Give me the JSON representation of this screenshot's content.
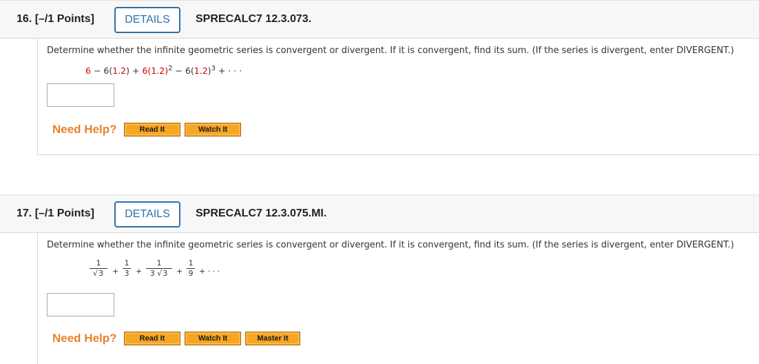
{
  "questions": [
    {
      "number": "16.",
      "points": "[–/1 Points]",
      "details_label": "DETAILS",
      "code": "SPRECALC7 12.3.073.",
      "prompt": "Determine whether the infinite geometric series is convergent or divergent. If it is convergent, find its sum. (If the series is divergent, enter DIVERGENT.)",
      "series": {
        "t1": "6",
        "op1": "−",
        "t2a": "6(",
        "t2b": "1.2",
        "t2c": ")",
        "op2": "+",
        "t3a": "6(",
        "t3b": "1.2",
        "t3c": ")",
        "t3exp": "2",
        "op3": "−",
        "t4a": "6(",
        "t4b": "1.2",
        "t4c": ")",
        "t4exp": "3",
        "op4": "+",
        "ellipsis": "· · ·"
      },
      "answer_value": "",
      "need_help": "Need Help?",
      "buttons": {
        "read": "Read It",
        "watch": "Watch It"
      }
    },
    {
      "number": "17.",
      "points": "[–/1 Points]",
      "details_label": "DETAILS",
      "code": "SPRECALC7 12.3.075.MI.",
      "prompt": "Determine whether the infinite geometric series is convergent or divergent. If it is convergent, find its sum. (If the series is divergent, enter DIVERGENT.)",
      "series": {
        "f1_num": "1",
        "f1_den": "3",
        "f2_num": "1",
        "f2_den": "3",
        "f3_num": "1",
        "f3_den_coef": "3",
        "f3_den_rad": "3",
        "f4_num": "1",
        "f4_den": "9",
        "plus": "+",
        "ellipsis": "+ · · ·",
        "sqrt_symbol": "√"
      },
      "answer_value": "",
      "need_help": "Need Help?",
      "buttons": {
        "read": "Read It",
        "watch": "Watch It",
        "master": "Master It"
      }
    }
  ]
}
